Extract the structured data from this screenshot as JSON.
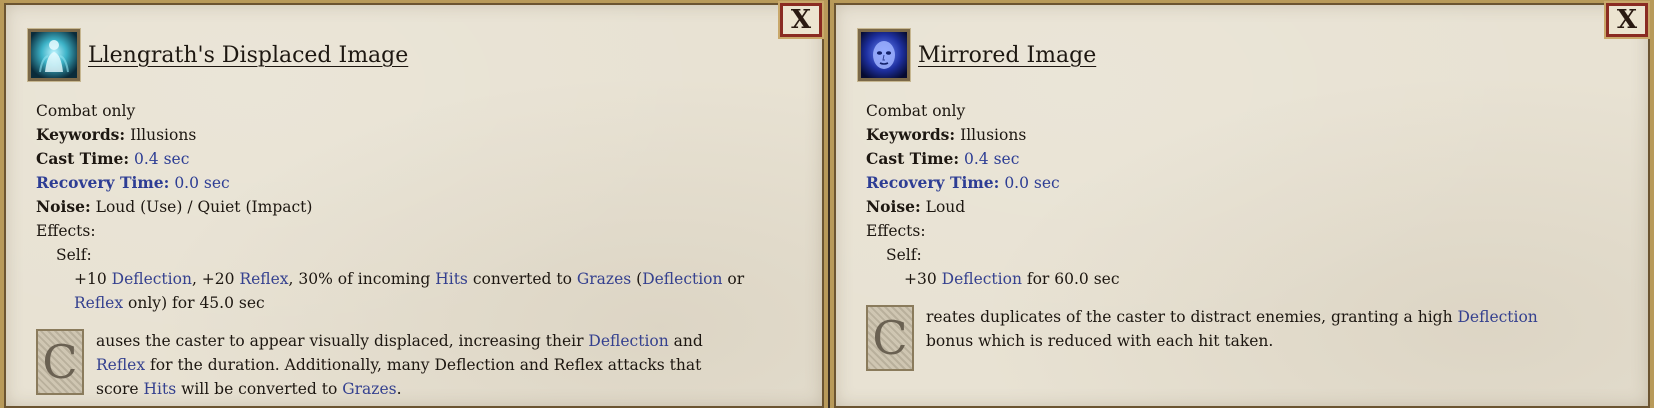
{
  "panels": [
    {
      "title": "Llengrath's Displaced Image",
      "icon": "glowing-figure-icon",
      "close_label": "X",
      "combat": "Combat only",
      "keywords_label": "Keywords:",
      "keywords_value": "Illusions",
      "cast_label": "Cast Time:",
      "cast_value": "0.4 sec",
      "recovery_label": "Recovery Time:",
      "recovery_value": "0.0 sec",
      "noise_label": "Noise:",
      "noise_value": "Loud (Use) / Quiet (Impact)",
      "effects_label": "Effects:",
      "self_label": "Self:",
      "effect_parts": [
        "+10 ",
        "Deflection",
        ", +20 ",
        "Reflex",
        ", 30% of incoming ",
        "Hits",
        " converted to ",
        "Grazes",
        " (",
        "Deflection",
        " or ",
        "Reflex",
        " only) for 45.0 sec"
      ],
      "dropcap": "C",
      "desc_parts": [
        "auses the caster to appear visually displaced, increasing their ",
        "Deflection",
        " and ",
        "Reflex",
        " for the duration. Additionally, many Deflection and Reflex attacks that score ",
        "Hits",
        " will be converted to ",
        "Grazes",
        "."
      ]
    },
    {
      "title": "Mirrored Image",
      "icon": "blue-face-icon",
      "close_label": "X",
      "combat": "Combat only",
      "keywords_label": "Keywords:",
      "keywords_value": "Illusions",
      "cast_label": "Cast Time:",
      "cast_value": "0.4 sec",
      "recovery_label": "Recovery Time:",
      "recovery_value": "0.0 sec",
      "noise_label": "Noise:",
      "noise_value": "Loud",
      "effects_label": "Effects:",
      "self_label": "Self:",
      "effect_parts": [
        "+30 ",
        "Deflection",
        " for 60.0 sec"
      ],
      "dropcap": "C",
      "desc_parts": [
        "reates duplicates of the caster to distract enemies, granting a high ",
        "Deflection",
        " bonus which is reduced with each hit taken."
      ]
    }
  ]
}
